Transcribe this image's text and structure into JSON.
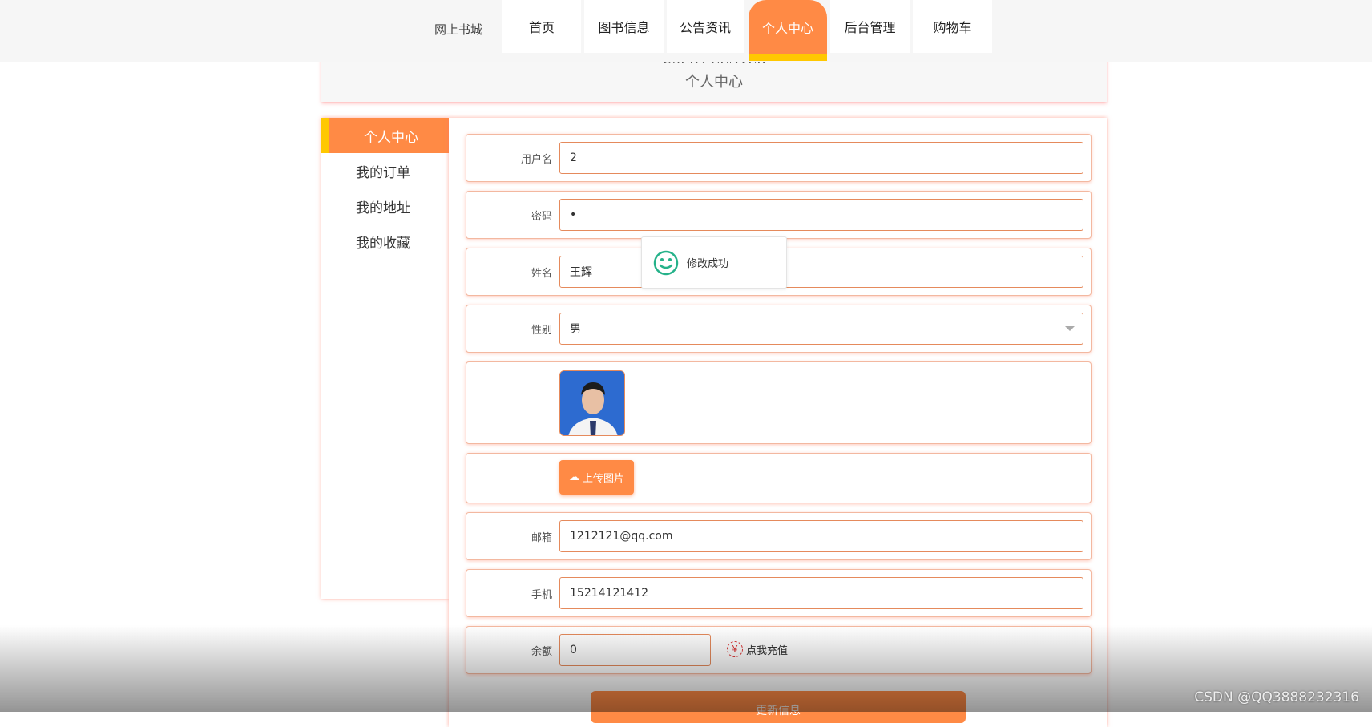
{
  "nav": {
    "brand": "网上书城",
    "tabs": [
      {
        "label": "首页"
      },
      {
        "label": "图书信息"
      },
      {
        "label": "公告资讯"
      },
      {
        "label": "个人中心",
        "active": true
      },
      {
        "label": "后台管理"
      },
      {
        "label": "购物车"
      }
    ]
  },
  "header": {
    "en": "USER / CENTER",
    "cn": "个人中心"
  },
  "sidebar": {
    "items": [
      {
        "label": "个人中心",
        "active": true
      },
      {
        "label": "我的订单"
      },
      {
        "label": "我的地址"
      },
      {
        "label": "我的收藏"
      }
    ]
  },
  "form": {
    "username": {
      "label": "用户名",
      "value": "2"
    },
    "password": {
      "label": "密码",
      "value": "•"
    },
    "name": {
      "label": "姓名",
      "value": "王辉"
    },
    "gender": {
      "label": "性别",
      "value": "男"
    },
    "upload_label": "上传图片",
    "email": {
      "label": "邮箱",
      "value": "1212121@qq.com"
    },
    "phone": {
      "label": "手机",
      "value": "15214121412"
    },
    "balance": {
      "label": "余额",
      "value": "0",
      "recharge": "点我充值"
    },
    "update_label": "更新信息"
  },
  "toast": {
    "message": "修改成功",
    "icon": "smile-icon"
  },
  "watermark": "CSDN @QQ3888232316",
  "colors": {
    "accent": "#ff8a45",
    "highlight": "#ffc800"
  }
}
